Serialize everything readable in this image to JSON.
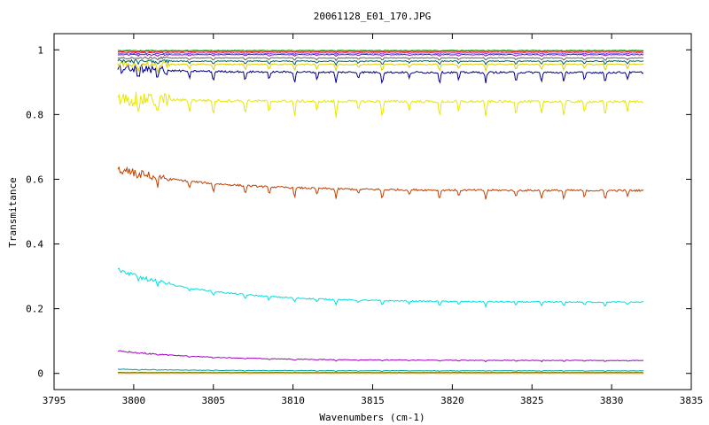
{
  "chart_data": {
    "type": "line",
    "title": "20061128_E01_170.JPG",
    "xlabel": "Wavenumbers (cm-1)",
    "ylabel": "Transmitance",
    "xlim": [
      3795,
      3835
    ],
    "ylim": [
      -0.05,
      1.05
    ],
    "x_ticks": [
      "3795",
      "3800",
      "3805",
      "3810",
      "3815",
      "3820",
      "3825",
      "3830",
      "3835"
    ],
    "y_ticks": [
      "0",
      "0.2",
      "0.4",
      "0.6",
      "0.8",
      "1"
    ],
    "x_range": [
      3799,
      3832
    ],
    "grid": false,
    "legend": "none",
    "absorption_lines": [
      3800.3,
      3801.5,
      3803.5,
      3805.0,
      3807.0,
      3808.5,
      3810.1,
      3811.5,
      3812.7,
      3814.1,
      3815.6,
      3817.3,
      3819.2,
      3820.4,
      3822.1,
      3824.0,
      3825.6,
      3827.0,
      3828.3,
      3829.6,
      3831.0
    ],
    "series": [
      {
        "color": "#ff8c00",
        "start": 0.0,
        "end": 0.0,
        "noise": 0.0005,
        "depth": 0.0
      },
      {
        "color": "#808000",
        "start": 0.003,
        "end": 0.003,
        "noise": 0.0005,
        "depth": 0.0
      },
      {
        "color": "#00a0a0",
        "start": 0.013,
        "end": 0.008,
        "noise": 0.0008,
        "depth": 0.002
      },
      {
        "color": "#a000c0",
        "start": 0.07,
        "end": 0.04,
        "noise": 0.001,
        "depth": 0.004
      },
      {
        "color": "#00e0e0",
        "start": 0.32,
        "end": 0.22,
        "noise": 0.002,
        "depth": 0.015
      },
      {
        "color": "#c04000",
        "start": 0.63,
        "end": 0.565,
        "noise": 0.003,
        "depth": 0.03
      },
      {
        "color": "#e8e800",
        "start": 0.85,
        "end": 0.84,
        "noise": 0.004,
        "depth": 0.05
      },
      {
        "color": "#00008b",
        "start": 0.94,
        "end": 0.93,
        "noise": 0.003,
        "depth": 0.035
      },
      {
        "color": "#e0d000",
        "start": 0.955,
        "end": 0.955,
        "noise": 0.002,
        "depth": 0.02
      },
      {
        "color": "#006060",
        "start": 0.965,
        "end": 0.965,
        "noise": 0.0015,
        "depth": 0.012
      },
      {
        "color": "#606060",
        "start": 0.975,
        "end": 0.975,
        "noise": 0.0012,
        "depth": 0.008
      },
      {
        "color": "#a000a0",
        "start": 0.985,
        "end": 0.985,
        "noise": 0.001,
        "depth": 0.005
      },
      {
        "color": "#4040ff",
        "start": 0.99,
        "end": 0.99,
        "noise": 0.001,
        "depth": 0.004
      },
      {
        "color": "#ff0000",
        "start": 0.995,
        "end": 0.995,
        "noise": 0.0008,
        "depth": 0.003
      },
      {
        "color": "#00a000",
        "start": 0.998,
        "end": 0.998,
        "noise": 0.0008,
        "depth": 0.002
      }
    ]
  }
}
